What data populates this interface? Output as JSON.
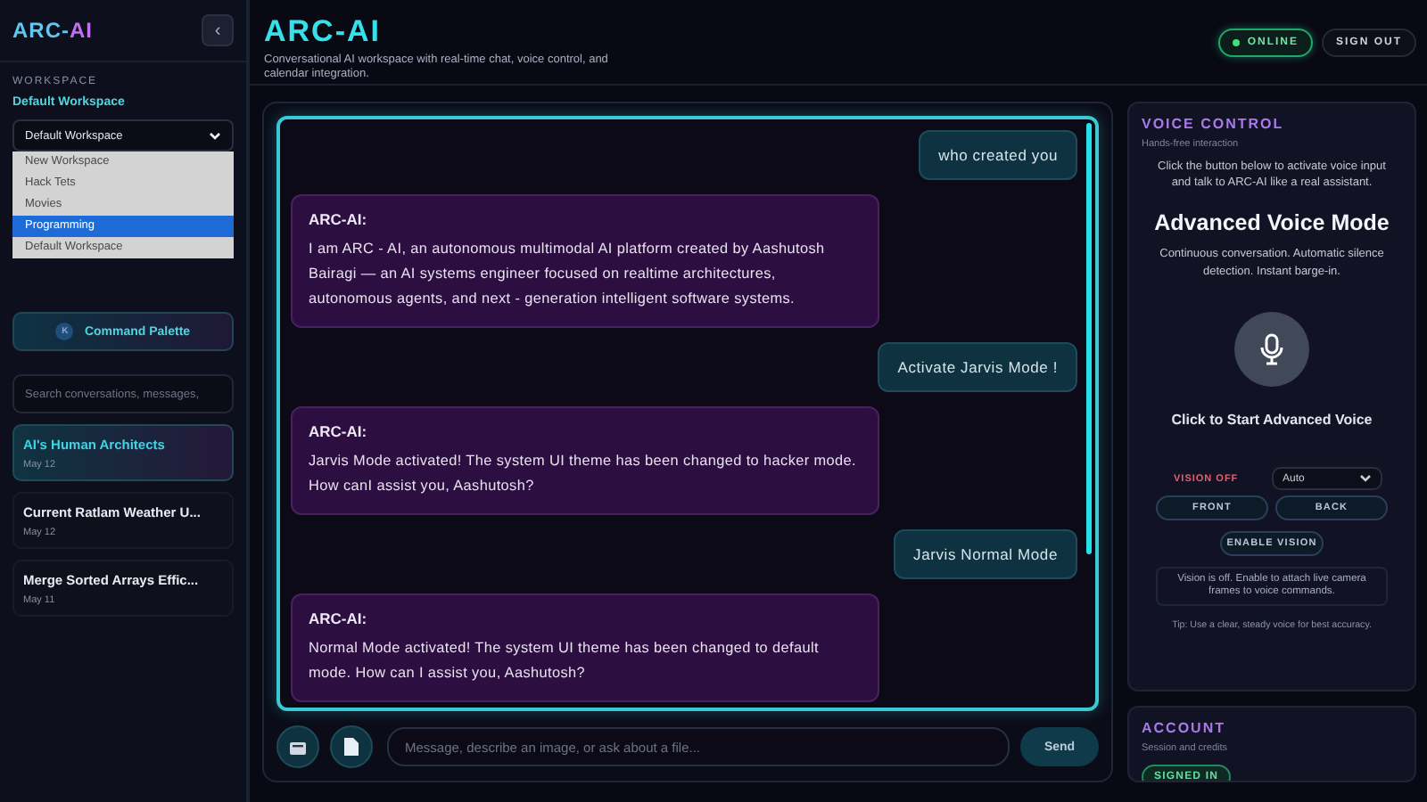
{
  "sidebar": {
    "logo": {
      "first": "ARC-",
      "second": "AI"
    },
    "collapse_button": "‹",
    "section_label": "WORKSPACE",
    "workspace_name": "Default Workspace",
    "workspace_select": "Default Workspace",
    "workspace_options": [
      {
        "label": "New Workspace",
        "selected": false
      },
      {
        "label": "Hack Tets",
        "selected": false
      },
      {
        "label": "Movies",
        "selected": false
      },
      {
        "label": "Programming",
        "selected": true
      },
      {
        "label": "Default Workspace",
        "selected": false
      }
    ],
    "command_palette": {
      "key": "K",
      "label": "Command Palette"
    },
    "search": {
      "placeholder": "Search conversations, messages,"
    },
    "conversations": [
      {
        "title": "AI's Human Architects",
        "date": "May 12",
        "selected": true
      },
      {
        "title": "Current Ratlam Weather U...",
        "date": "May 12",
        "selected": false
      },
      {
        "title": "Merge Sorted Arrays Effic...",
        "date": "May 11",
        "selected": false
      }
    ]
  },
  "header": {
    "title": "ARC-AI",
    "subtitle": "Conversational AI workspace with real-time chat, voice control, and calendar integration.",
    "status": {
      "label": "ONLINE",
      "online": true
    },
    "sign_out": "SIGN OUT"
  },
  "chat": {
    "messages": [
      {
        "kind": "user",
        "text": "who created you"
      },
      {
        "kind": "assistant",
        "sender": "ARC-AI:",
        "text": "I am ARC - AI, an autonomous multimodal AI platform created by Aashutosh Bairagi — an AI systems engineer focused on realtime architectures, autonomous agents, and next - generation intelligent software systems."
      },
      {
        "kind": "user",
        "text": "Activate Jarvis Mode !"
      },
      {
        "kind": "assistant",
        "sender": "ARC-AI:",
        "text": "Jarvis Mode activated! The system UI theme has been changed to hacker mode. How canI assist you, Aashutosh?"
      },
      {
        "kind": "user",
        "text": "Jarvis Normal Mode"
      },
      {
        "kind": "assistant",
        "sender": "ARC-AI:",
        "text": "Normal Mode activated! The system UI theme has been changed to default mode. How can I assist you, Aashutosh?"
      }
    ],
    "input": {
      "placeholder": "Message, describe an image, or ask about a file..."
    },
    "send": "Send"
  },
  "voice_control": {
    "title": "VOICE CONTROL",
    "subtitle": "Hands-free interaction",
    "intro": "Click the button below to activate voice input and talk to ARC-AI like a real assistant.",
    "mode_title": "Advanced Voice Mode",
    "mode_text": "Continuous conversation. Automatic silence detection. Instant barge-in.",
    "start_label": "Click to Start Advanced Voice",
    "vision": {
      "status": "VISION OFF",
      "on": false,
      "camera_select": "Auto",
      "front": "FRONT",
      "back": "BACK",
      "enable": "ENABLE VISION",
      "note": "Vision is off. Enable to attach live camera frames to voice commands."
    },
    "tip": "Tip: Use a clear, steady voice for best accuracy."
  },
  "account": {
    "title": "ACCOUNT",
    "subtitle": "Session and credits",
    "badge": "SIGNED IN"
  }
}
